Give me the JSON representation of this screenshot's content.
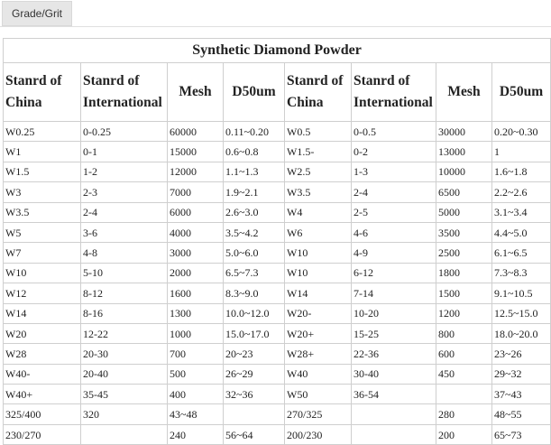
{
  "tab": {
    "label": "Grade/Grit"
  },
  "table": {
    "title": "Synthetic Diamond Powder",
    "headers": [
      [
        "Stanrd of",
        "China"
      ],
      [
        "Stanrd of",
        "International"
      ],
      [
        "Mesh"
      ],
      [
        "D50um"
      ],
      [
        "Stanrd of",
        "China"
      ],
      [
        "Stanrd of",
        "International"
      ],
      [
        "Mesh"
      ],
      [
        "D50um"
      ]
    ],
    "rows": [
      [
        "W0.25",
        "0-0.25",
        "60000",
        "0.11~0.20",
        "W0.5",
        "0-0.5",
        "30000",
        "0.20~0.30"
      ],
      [
        "W1",
        "0-1",
        "15000",
        "0.6~0.8",
        "W1.5-",
        "0-2",
        "13000",
        "1"
      ],
      [
        "W1.5",
        "1-2",
        "12000",
        "1.1~1.3",
        "W2.5",
        "1-3",
        "10000",
        "1.6~1.8"
      ],
      [
        "W3",
        "2-3",
        "7000",
        "1.9~2.1",
        "W3.5",
        "2-4",
        "6500",
        "2.2~2.6"
      ],
      [
        "W3.5",
        "2-4",
        "6000",
        "2.6~3.0",
        "W4",
        "2-5",
        "5000",
        "3.1~3.4"
      ],
      [
        "W5",
        "3-6",
        "4000",
        "3.5~4.2",
        "W6",
        "4-6",
        "3500",
        "4.4~5.0"
      ],
      [
        "W7",
        "4-8",
        "3000",
        "5.0~6.0",
        "W10",
        "4-9",
        "2500",
        "6.1~6.5"
      ],
      [
        "W10",
        "5-10",
        "2000",
        "6.5~7.3",
        "W10",
        "6-12",
        "1800",
        "7.3~8.3"
      ],
      [
        "W12",
        "8-12",
        "1600",
        "8.3~9.0",
        "W14",
        "7-14",
        "1500",
        "9.1~10.5"
      ],
      [
        "W14",
        "8-16",
        "1300",
        "10.0~12.0",
        "W20-",
        "10-20",
        "1200",
        "12.5~15.0"
      ],
      [
        "W20",
        "12-22",
        "1000",
        "15.0~17.0",
        "W20+",
        "15-25",
        "800",
        "18.0~20.0"
      ],
      [
        "W28",
        "20-30",
        "700",
        "20~23",
        "W28+",
        "22-36",
        "600",
        "23~26"
      ],
      [
        "W40-",
        "20-40",
        "500",
        "26~29",
        "W40",
        "30-40",
        "450",
        "29~32"
      ],
      [
        "W40+",
        "35-45",
        "400",
        "32~36",
        "W50",
        "36-54",
        "",
        "37~43"
      ],
      [
        "325/400",
        "320",
        "43~48",
        "",
        "270/325",
        "",
        "280",
        "48~55"
      ],
      [
        "230/270",
        "",
        "240",
        "56~64",
        "200/230",
        "",
        "200",
        "65~73"
      ]
    ]
  }
}
